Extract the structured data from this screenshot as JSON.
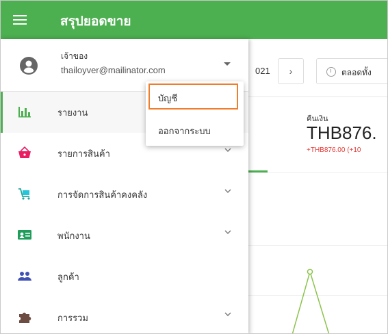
{
  "appbar": {
    "title": "สรุปยอดขาย"
  },
  "background": {
    "date_fragment": "021",
    "next_arrow": "›",
    "period_label": "ตลอดทั้ง",
    "refund_label": "คืนเงิน",
    "refund_value": "THB876.",
    "refund_change": "+THB876.00 (+10"
  },
  "account": {
    "role": "เจ้าของ",
    "email": "thailoyver@mailinator.com"
  },
  "nav": {
    "items": [
      {
        "label": "รายงาน",
        "icon": "bar-chart-icon",
        "active": true
      },
      {
        "label": "รายการสินค้า",
        "icon": "basket-icon",
        "active": false
      },
      {
        "label": "การจัดการสินค้าคงคลัง",
        "icon": "cart-icon",
        "active": false
      },
      {
        "label": "พนักงาน",
        "icon": "id-card-icon",
        "active": false
      },
      {
        "label": "ลูกค้า",
        "icon": "people-icon",
        "active": false
      },
      {
        "label": "การรวม",
        "icon": "puzzle-icon",
        "active": false
      }
    ]
  },
  "popup": {
    "items": [
      {
        "label": "บัญชี"
      },
      {
        "label": "ออกจากระบบ"
      }
    ]
  },
  "colors": {
    "brand": "#4caf50",
    "highlight": "#f07d2a",
    "negative": "#e53935"
  }
}
